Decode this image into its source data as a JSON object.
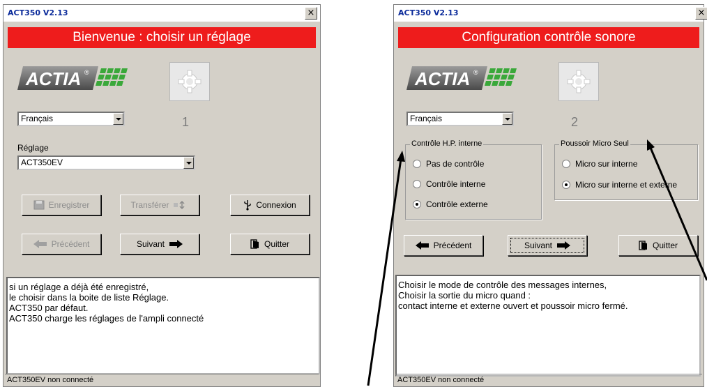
{
  "window1": {
    "title": "ACT350 V2.13",
    "close": "×",
    "banner": "Bienvenue : choisir un réglage",
    "logo_text": "ACTIA",
    "language": "Français",
    "step": "1",
    "reglage_label": "Réglage",
    "reglage_value": "ACT350EV",
    "buttons": {
      "enregistrer": "Enregistrer",
      "transferer": "Transférer",
      "connexion": "Connexion",
      "precedent": "Précédent",
      "suivant": "Suivant",
      "quitter": "Quitter"
    },
    "text": "si un réglage a déjà été enregistré,\nle choisir dans la boite de liste Réglage.\nACT350 par défaut.\nACT350 charge les réglages de l'ampli connecté",
    "status": "ACT350EV non connecté"
  },
  "window2": {
    "title": "ACT350 V2.13",
    "close": "×",
    "banner": "Configuration contrôle sonore",
    "logo_text": "ACTIA",
    "language": "Français",
    "step": "2",
    "group1": {
      "legend": "Contrôle H.P. interne",
      "options": [
        "Pas de contrôle",
        "Contrôle interne",
        "Contrôle externe"
      ],
      "selected": 2
    },
    "group2": {
      "legend": "Poussoir Micro Seul",
      "options": [
        "Micro sur interne",
        "Micro sur interne et externe"
      ],
      "selected": 1
    },
    "buttons": {
      "precedent": "Précédent",
      "suivant": "Suivant",
      "quitter": "Quitter"
    },
    "text": "Choisir le mode de contrôle des messages internes,\nChoisir la sortie du micro quand :\ncontact interne et externe ouvert et poussoir micro fermé.",
    "status": "ACT350EV non connecté"
  },
  "colors": {
    "banner": "#ee1c1c",
    "title_text": "#0a2a9a",
    "window_bg": "#d4d0c8",
    "logo_green": "#3aa83a"
  }
}
